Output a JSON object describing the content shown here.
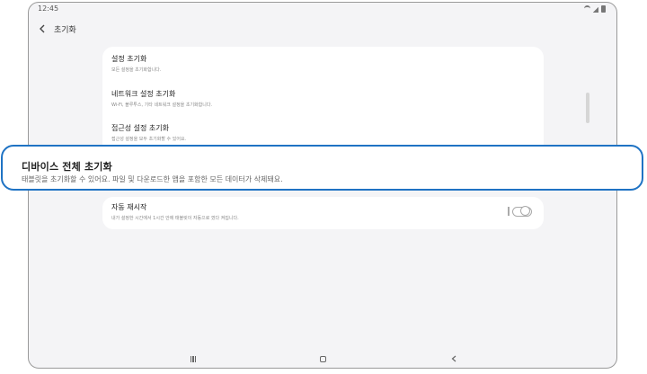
{
  "status_bar": {
    "time": "12:45",
    "icons": [
      "wifi-icon",
      "signal-icon",
      "battery-icon"
    ]
  },
  "header": {
    "back_icon": "chevron-left",
    "title": "초기화"
  },
  "settings_items": [
    {
      "title": "설정 초기화",
      "description": "모든 설정을 초기화합니다."
    },
    {
      "title": "네트워크 설정 초기화",
      "description": "Wi-Fi, 블루투스, 기타 네트워크 설정을 초기화합니다."
    },
    {
      "title": "접근성 설정 초기화",
      "description": "접근성 설정을 모두 초기화할 수 있어요."
    }
  ],
  "highlighted_item": {
    "title": "디바이스 전체 초기화",
    "description": "태블릿을 초기화할 수 있어요. 파일 및 다운로드한 앱을 포함한 모든 데이터가 삭제돼요.",
    "highlight_color": "#1f73c4"
  },
  "auto_restart": {
    "title": "자동 재시작",
    "description": "내가 설정한 시간에서 1시간 안에 태블릿이 자동으로 껐다 켜집니다.",
    "toggle_on": false
  },
  "nav_bar": {
    "buttons": [
      "recents-icon",
      "home-icon",
      "back-icon"
    ]
  }
}
